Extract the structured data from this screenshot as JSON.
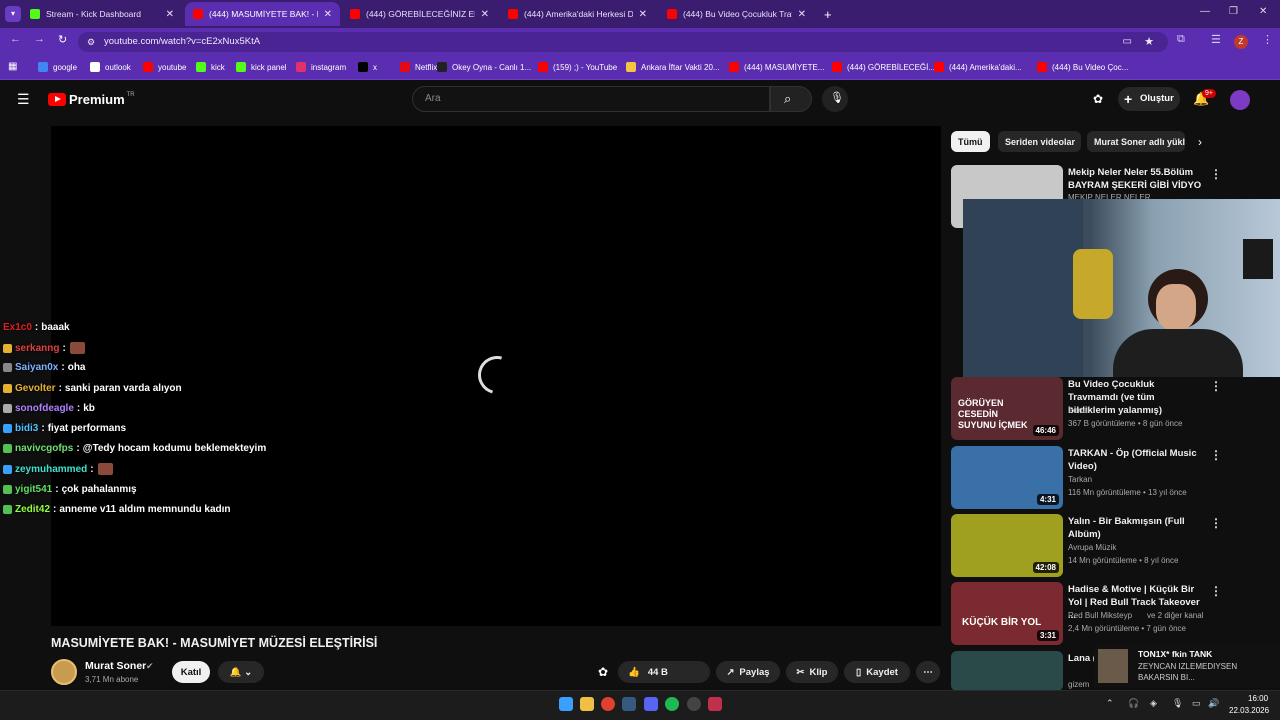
{
  "browser": {
    "tabs": [
      {
        "title": "Stream - Kick Dashboard",
        "favicon": "kick-icon",
        "active": false
      },
      {
        "title": "(444) MASUMİYETE BAK! - MA",
        "favicon": "youtube-icon",
        "active": true
      },
      {
        "title": "(444) GÖREBİLECEĞİNİZ EN ŞE",
        "favicon": "youtube-icon",
        "active": false
      },
      {
        "title": "(444) Amerika'daki Herkesi Ded",
        "favicon": "youtube-icon",
        "active": false
      },
      {
        "title": "(444) Bu Video Çocukluk Travm",
        "favicon": "youtube-icon",
        "active": false
      }
    ],
    "url": "youtube.com/watch?v=cE2xNux5KtA",
    "bookmarks": [
      "google",
      "outlook",
      "youtube",
      "kick",
      "kick panel",
      "instagram",
      "x",
      "Netflix",
      "Okey Oyna - Canlı 1...",
      "(159) ;) - YouTube",
      "Ankara İftar Vakti 20...",
      "(444) MASUMİYETE...",
      "(444) GÖREBİLECEĞİ...",
      "(444) Amerika'daki...",
      "(444) Bu Video Çoc..."
    ],
    "accent": "#5b2db0"
  },
  "youtube": {
    "logo": "Premium",
    "logo_region": "TR",
    "search_placeholder": "Ara",
    "create_label": "Oluştur",
    "notif_count": "9+"
  },
  "chat": [
    {
      "user": "Ex1c0",
      "color": "#e02020",
      "msg": "baaak",
      "emote": false
    },
    {
      "user": "serkanng",
      "color": "#e04040",
      "msg": "",
      "emote": true
    },
    {
      "user": "Saiyan0x",
      "color": "#7fb0ff",
      "msg": "oha",
      "emote": false
    },
    {
      "user": "Gevolter",
      "color": "#e6b030",
      "msg": "sanki paran varda alıyon",
      "emote": false
    },
    {
      "user": "sonofdeagle",
      "color": "#b080ff",
      "msg": "kb",
      "emote": false
    },
    {
      "user": "bidi3",
      "color": "#50c0ff",
      "msg": "fiyat performans",
      "emote": false
    },
    {
      "user": "navivcgofps",
      "color": "#6fe06f",
      "msg": "@Tedy hocam kodumu beklemekteyim",
      "emote": false
    },
    {
      "user": "zeymuhammed",
      "color": "#40e0d0",
      "msg": "",
      "emote": true
    },
    {
      "user": "yigit541",
      "color": "#60e060",
      "msg": "çok pahalanmış",
      "emote": false
    },
    {
      "user": "Zedit42",
      "color": "#90ff40",
      "msg": "anneme v11 aldım memnundu kadın",
      "emote": false
    }
  ],
  "video": {
    "title": "MASUMİYETE BAK! - MASUMİYET MÜZESİ ELEŞTİRİSİ",
    "channel": "Murat Soner",
    "subs": "3,71 Mn abone",
    "join": "Katıl",
    "likes": "44 B",
    "share": "Paylaş",
    "clip": "Klip",
    "save": "Kaydet"
  },
  "chips": [
    "Tümü",
    "Seriden videolar",
    "Murat Soner adlı yükl"
  ],
  "related": [
    {
      "title": "Mekip Neler Neler 55.Bölüm BAYRAM ŞEKERİ GİBİ VİDYO ...",
      "channel": "MEKIP NELER NELER",
      "meta": "",
      "duration": "",
      "thumb": "#c8c8c8"
    },
    {
      "title": "Bu Video Çocukluk Travmamdı (ve tüm bildiklerim yalanmış)",
      "channel": "Portal",
      "meta": "367 B görüntüleme • 8 gün önce",
      "duration": "46:46",
      "thumb": "#5a2a30"
    },
    {
      "title": "TARKAN - Öp (Official Music Video)",
      "channel": "Tarkan",
      "meta": "116 Mn görüntüleme • 13 yıl önce",
      "duration": "4:31",
      "thumb": "#3a70a8"
    },
    {
      "title": "Yalın - Bir Bakmışsın (Full Albüm)",
      "channel": "Avrupa Müzik",
      "meta": "14 Mn görüntüleme • 8 yıl önce",
      "duration": "42:08",
      "thumb": "#a0a020"
    },
    {
      "title": "Hadise & Motive | Küçük Bir Yol | Red Bull Track Takeover ...",
      "channel": "Red Bull Miksteyp",
      "meta": "2,4 Mn görüntüleme • 7 gün önce",
      "duration": "3:31",
      "thumb": "#7a2a30"
    },
    {
      "title": "Lana (Türk",
      "channel": "gizem",
      "meta": "",
      "duration": "",
      "thumb": "#2a4a4a"
    }
  ],
  "related_extra": {
    "channel_suffix": "ve 2 diğer kanal"
  },
  "notification": {
    "title": "TON1X* fkin TANK",
    "body": "ZEYNCAN IZLEMEDIYSEN BAKARSIN BI..."
  },
  "thumb_texts": {
    "portal": "GÖRÜYEN CESEDİN SUYUNU İÇMEK",
    "redbull": "KÜÇÜK BİR YOL"
  },
  "clock": {
    "time": "16:00",
    "date": "22.03.2026"
  }
}
